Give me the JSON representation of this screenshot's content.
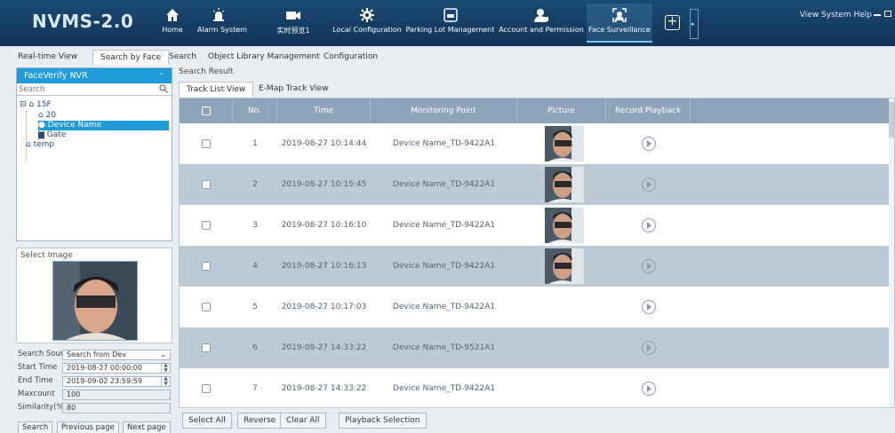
{
  "app": {
    "logo": "NVMS-2.0",
    "system_menu": "View System Help"
  },
  "nav": {
    "items": [
      {
        "label": "Home",
        "icon": "home-icon"
      },
      {
        "label": "Alarm System",
        "icon": "alarm-icon"
      },
      {
        "label": "实时预览1",
        "icon": "camera-icon"
      },
      {
        "label": "Local Configuration",
        "icon": "gear-icon"
      },
      {
        "label": "Parking Lot Management",
        "icon": "parking-icon"
      },
      {
        "label": "Account and Permission",
        "icon": "account-icon"
      },
      {
        "label": "Face Surveillance",
        "icon": "face-icon"
      }
    ],
    "add_label": "+"
  },
  "tabs": [
    "Real-time View",
    "Search by Face",
    "Search",
    "Object Library Management",
    "Configuration"
  ],
  "tree": {
    "title": "FaceVerify NVR",
    "search_placeholder": "Search",
    "nodes": [
      "15F",
      "20",
      "Device Name",
      "Gate",
      "temp"
    ]
  },
  "select_image": {
    "label": "Select Image"
  },
  "form": {
    "search_source_label": "Search Source",
    "search_source_value": "Search from Dev",
    "start_time_label": "Start Time",
    "start_time_value": "2019-08-27 00:00:00",
    "end_time_label": "End Time",
    "end_time_value": "2019-09-02 23:59:59",
    "maxcount_label": "Maxcount",
    "maxcount_value": "100",
    "similarity_label": "Similarity(%)",
    "similarity_value": "80"
  },
  "left_buttons": [
    "Search",
    "Previous page",
    "Next page"
  ],
  "result": {
    "label": "Search Result",
    "subtabs": [
      "Track List View",
      "E-Map Track View"
    ],
    "columns": [
      "No.",
      "Time",
      "Monitoring Point",
      "Picture",
      "Record Playback"
    ],
    "rows": [
      {
        "no": "1",
        "time": "2019-08-27 10:14:44",
        "point": "Device Name_TD-9422A1",
        "has_picture": true
      },
      {
        "no": "2",
        "time": "2019-08-27 10:15:45",
        "point": "Device Name_TD-9422A1",
        "has_picture": true
      },
      {
        "no": "3",
        "time": "2019-08-27 10:16:10",
        "point": "Device Name_TD-9422A1",
        "has_picture": true
      },
      {
        "no": "4",
        "time": "2019-08-27 10:16:13",
        "point": "Device Name_TD-9422A1",
        "has_picture": true
      },
      {
        "no": "5",
        "time": "2019-08-27 10:17:03",
        "point": "Device Name_TD-9422A1",
        "has_picture": false
      },
      {
        "no": "6",
        "time": "2019-08-27 14:33:22",
        "point": "Device Name_TD-9521A1",
        "has_picture": false
      },
      {
        "no": "7",
        "time": "2019-08-27 14:33:22",
        "point": "Device Name_TD-9422A1",
        "has_picture": false
      }
    ]
  },
  "bottom_buttons": [
    "Select All",
    "Reverse",
    "Clear All",
    "Playback Selection"
  ],
  "colors": {
    "topbar": "#0f3356",
    "accent": "#1e9bd8",
    "row_alt": "#bccad6",
    "header": "#8ea4b8"
  }
}
